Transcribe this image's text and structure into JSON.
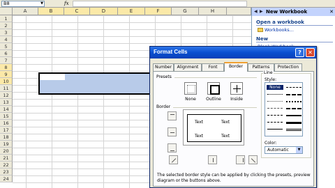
{
  "formula_bar": {
    "name_box": "B8",
    "fx": "fx"
  },
  "sheet": {
    "columns": [
      "A",
      "B",
      "C",
      "D",
      "E",
      "F",
      "G",
      "H"
    ],
    "rows": [
      "1",
      "2",
      "3",
      "4",
      "5",
      "6",
      "7",
      "8",
      "9",
      "10",
      "11",
      "12",
      "13",
      "14",
      "15",
      "16",
      "17",
      "18",
      "19",
      "20",
      "21",
      "22",
      "23",
      "24"
    ]
  },
  "task_pane": {
    "title": "New Workbook",
    "section_open": "Open a workbook",
    "link_workbooks": "Workbooks...",
    "section_new": "New",
    "link_blank": "Blank Workbook"
  },
  "dialog": {
    "title": "Format Cells",
    "help_glyph": "?",
    "close_glyph": "✕",
    "tabs": [
      "Number",
      "Alignment",
      "Font",
      "Border",
      "Patterns",
      "Protection"
    ],
    "active_tab": "Border",
    "presets_label": "Presets",
    "presets": [
      "None",
      "Outline",
      "Inside"
    ],
    "border_label": "Border",
    "preview_text": [
      "Text",
      "Text",
      "Text",
      "Text"
    ],
    "line_label": "Line",
    "style_label": "Style:",
    "style_none": "None",
    "color_label": "Color:",
    "color_value": "Automatic",
    "help_text": "The selected border style can be applied by clicking the presets, preview diagram or the buttons above."
  }
}
